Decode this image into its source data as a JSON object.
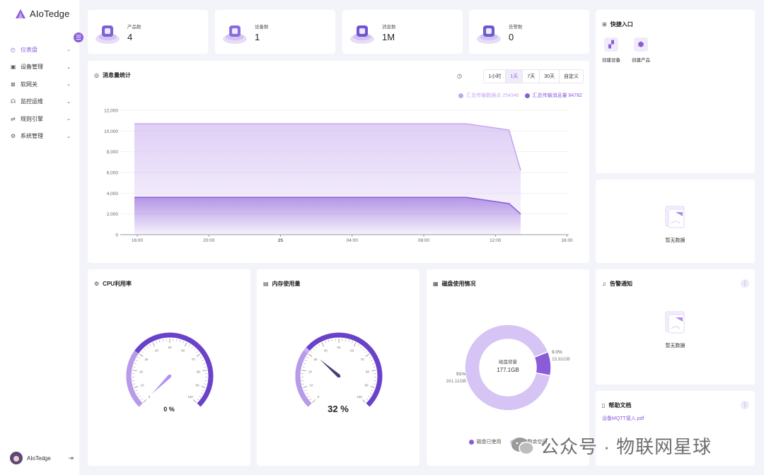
{
  "app": {
    "name": "AIoTedge"
  },
  "sidebar": {
    "collapse_icon": "menu-fold-icon",
    "items": [
      {
        "label": "仪表盘",
        "icon": "◴",
        "active": true
      },
      {
        "label": "设备管理",
        "icon": "▣",
        "active": false
      },
      {
        "label": "软网关",
        "icon": "⊠",
        "active": false
      },
      {
        "label": "监控运维",
        "icon": "☊",
        "active": false
      },
      {
        "label": "规则引擎",
        "icon": "⇄",
        "active": false
      },
      {
        "label": "系统管理",
        "icon": "⚙",
        "active": false
      }
    ],
    "user": {
      "name": "AIoTedge",
      "logout_icon": "⇥"
    }
  },
  "stats": [
    {
      "label": "产品数",
      "value": "4",
      "icon": "product-icon"
    },
    {
      "label": "设备数",
      "value": "1",
      "icon": "device-icon"
    },
    {
      "label": "消息数",
      "value": "1M",
      "icon": "message-icon"
    },
    {
      "label": "告警数",
      "value": "0",
      "icon": "alarm-icon"
    }
  ],
  "message_chart": {
    "title": "消息量统计",
    "ranges": [
      "1小时",
      "1天",
      "7天",
      "30天",
      "自定义"
    ],
    "selected_range": "1天"
  },
  "chart_data": {
    "type": "area",
    "x": [
      "16:00",
      "20:00",
      "25",
      "04:00",
      "08:00",
      "12:00",
      "16:00"
    ],
    "ylim": [
      0,
      12000
    ],
    "yticks": [
      "0",
      "2,000",
      "4,000",
      "6,000",
      "8,000",
      "10,000",
      "12,000"
    ],
    "series": [
      {
        "name": "汇总传输数据点 254346",
        "color": "#c4a6ee",
        "points": [
          [
            0,
            10700
          ],
          [
            0.86,
            10700
          ],
          [
            0.97,
            10100
          ],
          [
            1.0,
            6200
          ]
        ]
      },
      {
        "name": "汇总传输消息量 84782",
        "color": "#8a5cd8",
        "points": [
          [
            0,
            3600
          ],
          [
            0.86,
            3600
          ],
          [
            0.97,
            3000
          ],
          [
            1.0,
            2000
          ]
        ]
      }
    ],
    "legend_position": "top-right"
  },
  "quick_access": {
    "title": "快捷入口",
    "items": [
      {
        "label": "创建设备",
        "icon": "▞"
      },
      {
        "label": "创建产品",
        "icon": "⬢"
      }
    ]
  },
  "empty_text": "暂无数据",
  "cpu": {
    "title": "CPU利用率",
    "value": 0,
    "display": "0 %",
    "ticks": [
      "0",
      "10",
      "20",
      "30",
      "40",
      "50",
      "60",
      "70",
      "80",
      "90",
      "100"
    ]
  },
  "memory": {
    "title": "内存使用量",
    "value": 32,
    "display": "32 %",
    "ticks": [
      "0",
      "10",
      "20",
      "30",
      "40",
      "50",
      "60",
      "70",
      "80",
      "90",
      "100"
    ]
  },
  "disk": {
    "title": "磁盘使用情况",
    "center_label": "磁盘容量",
    "center_value": "177.1GB",
    "slices": [
      {
        "name": "磁盘已使用",
        "percent": "9.0%",
        "size": "15.91GB",
        "fraction": 0.09,
        "color": "#8a5cd8"
      },
      {
        "name": "磁盘剩余空间",
        "percent": "91%",
        "size": "161.11GB",
        "fraction": 0.91,
        "color": "#d5c4f4"
      }
    ]
  },
  "alarms": {
    "title": "告警通知"
  },
  "help": {
    "title": "帮助文档",
    "link": "设备MQTT接入.pdf"
  },
  "watermark": "公众号 · 物联网星球"
}
